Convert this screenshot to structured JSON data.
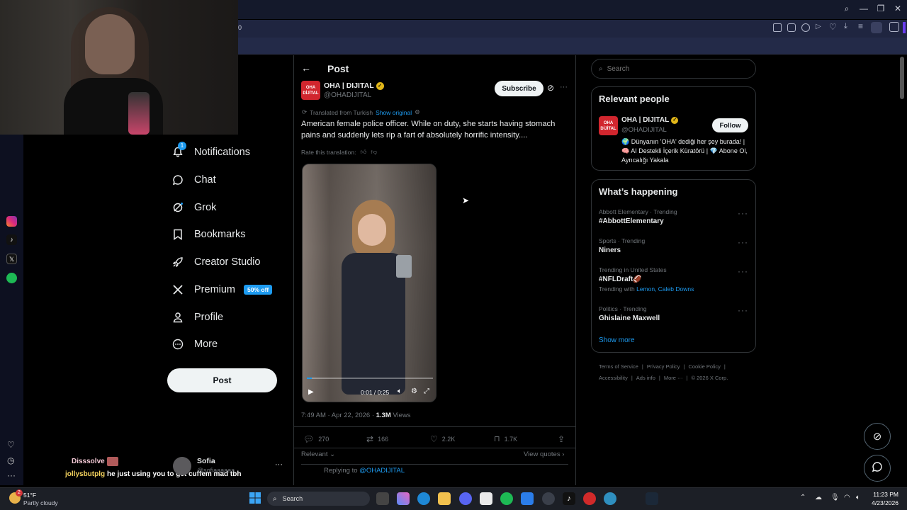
{
  "colors": {
    "accent": "#1d9bf0",
    "muted": "#71767b",
    "brand_red": "#d1262e",
    "premium_badge": "#1d9bf0"
  },
  "nav": {
    "items": [
      {
        "label": "Notifications",
        "icon": "bell-icon",
        "badge": "1"
      },
      {
        "label": "Chat",
        "icon": "chat-icon"
      },
      {
        "label": "Grok",
        "icon": "grok-icon"
      },
      {
        "label": "Bookmarks",
        "icon": "bookmark-icon"
      },
      {
        "label": "Creator Studio",
        "icon": "rocket-icon"
      },
      {
        "label": "Premium",
        "icon": "x-logo-icon",
        "badge": "50% off"
      },
      {
        "label": "Profile",
        "icon": "person-icon"
      },
      {
        "label": "More",
        "icon": "more-circle-icon"
      }
    ],
    "post_button": "Post"
  },
  "post": {
    "header": "Post",
    "author_name": "OHA | DIJITAL",
    "author_handle": "@OHADIJITAL",
    "avatar_text": "OHA DİJİTAL",
    "subscribe": "Subscribe",
    "translated_from": "Translated from Turkish",
    "show_original": "Show original",
    "text": "American female police officer. While on duty, she starts having stomach pains and suddenly lets rip a fart of absolutely horrific intensity....",
    "rate_translation": "Rate this translation:",
    "video_time": "0:01 / 0:25",
    "video_progress": 0.04,
    "timestamp": "7:49 AM · Apr 22, 2026 · ",
    "views_count": "1.3M",
    "views_label": " Views",
    "stats": {
      "replies": "270",
      "reposts": "166",
      "likes": "2.2K",
      "bookmarks": "1.7K"
    },
    "relevant": "Relevant",
    "view_quotes": "View quotes",
    "replying_to": "Replying to ",
    "replying_handle": "@OHADIJITAL"
  },
  "search": {
    "placeholder": "Search"
  },
  "relevant_people": {
    "title": "Relevant people",
    "name": "OHA | DIJITAL",
    "handle": "@OHADIJITAL",
    "bio": "🌍 Dünyanın 'OHA' dediği her şey burada! | 🧠 AI Destekli İçerik Küratörü | 💎 Abone Ol, Ayrıcalığı Yakala",
    "follow": "Follow"
  },
  "whats_happening": {
    "title": "What’s happening",
    "trends": [
      {
        "context": "Abbott Elementary · Trending",
        "name": "#AbbottElementary"
      },
      {
        "context": "Sports · Trending",
        "name": "Niners"
      },
      {
        "context": "Trending in United States",
        "name": "#NFLDraft🏈",
        "with_label": "Trending with ",
        "with_links": "Lemon, Caleb Downs"
      },
      {
        "context": "Politics · Trending",
        "name": "Ghislaine Maxwell"
      }
    ],
    "show_more": "Show more"
  },
  "footer": {
    "line1": [
      "Terms of Service",
      "Privacy Policy",
      "Cookie Policy"
    ],
    "line2": [
      "Accessibility",
      "Ads info",
      "More ···",
      "© 2026 X Corp."
    ]
  },
  "account": {
    "name": "Sofia",
    "handle": "@sofiaaaaaa"
  },
  "chat_overlay": [
    {
      "user": "Disssolve",
      "text": ""
    },
    {
      "user": "jollysbutplg",
      "text": "he just using you to get cuffem mad tbh"
    }
  ],
  "url_fragment": "0",
  "taskbar": {
    "weather_temp": "51°F",
    "weather_desc": "Partly cloudy",
    "search_placeholder": "Search",
    "time": "11:23 PM",
    "date": "4/23/2026",
    "notification_count": "2"
  }
}
